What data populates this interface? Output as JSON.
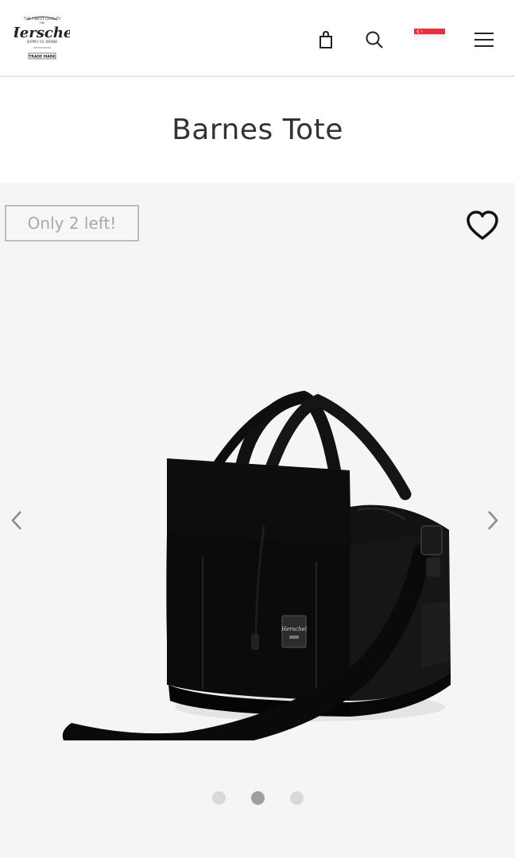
{
  "header": {
    "logo_alt": "Herschel Supply Co. Brand Trade Mark",
    "icons": [
      "bag-icon",
      "search-icon",
      "singapore-flag-icon",
      "menu-icon"
    ]
  },
  "product": {
    "title": "Barnes Tote",
    "stock_badge": "Only 2 left!"
  },
  "gallery": {
    "slide_count": 3,
    "active_slide": 2
  },
  "colors": {
    "accent_flag_red": "#e5303b",
    "badge_border": "#bdbdbd",
    "gallery_bg": "#f5f5f5"
  }
}
